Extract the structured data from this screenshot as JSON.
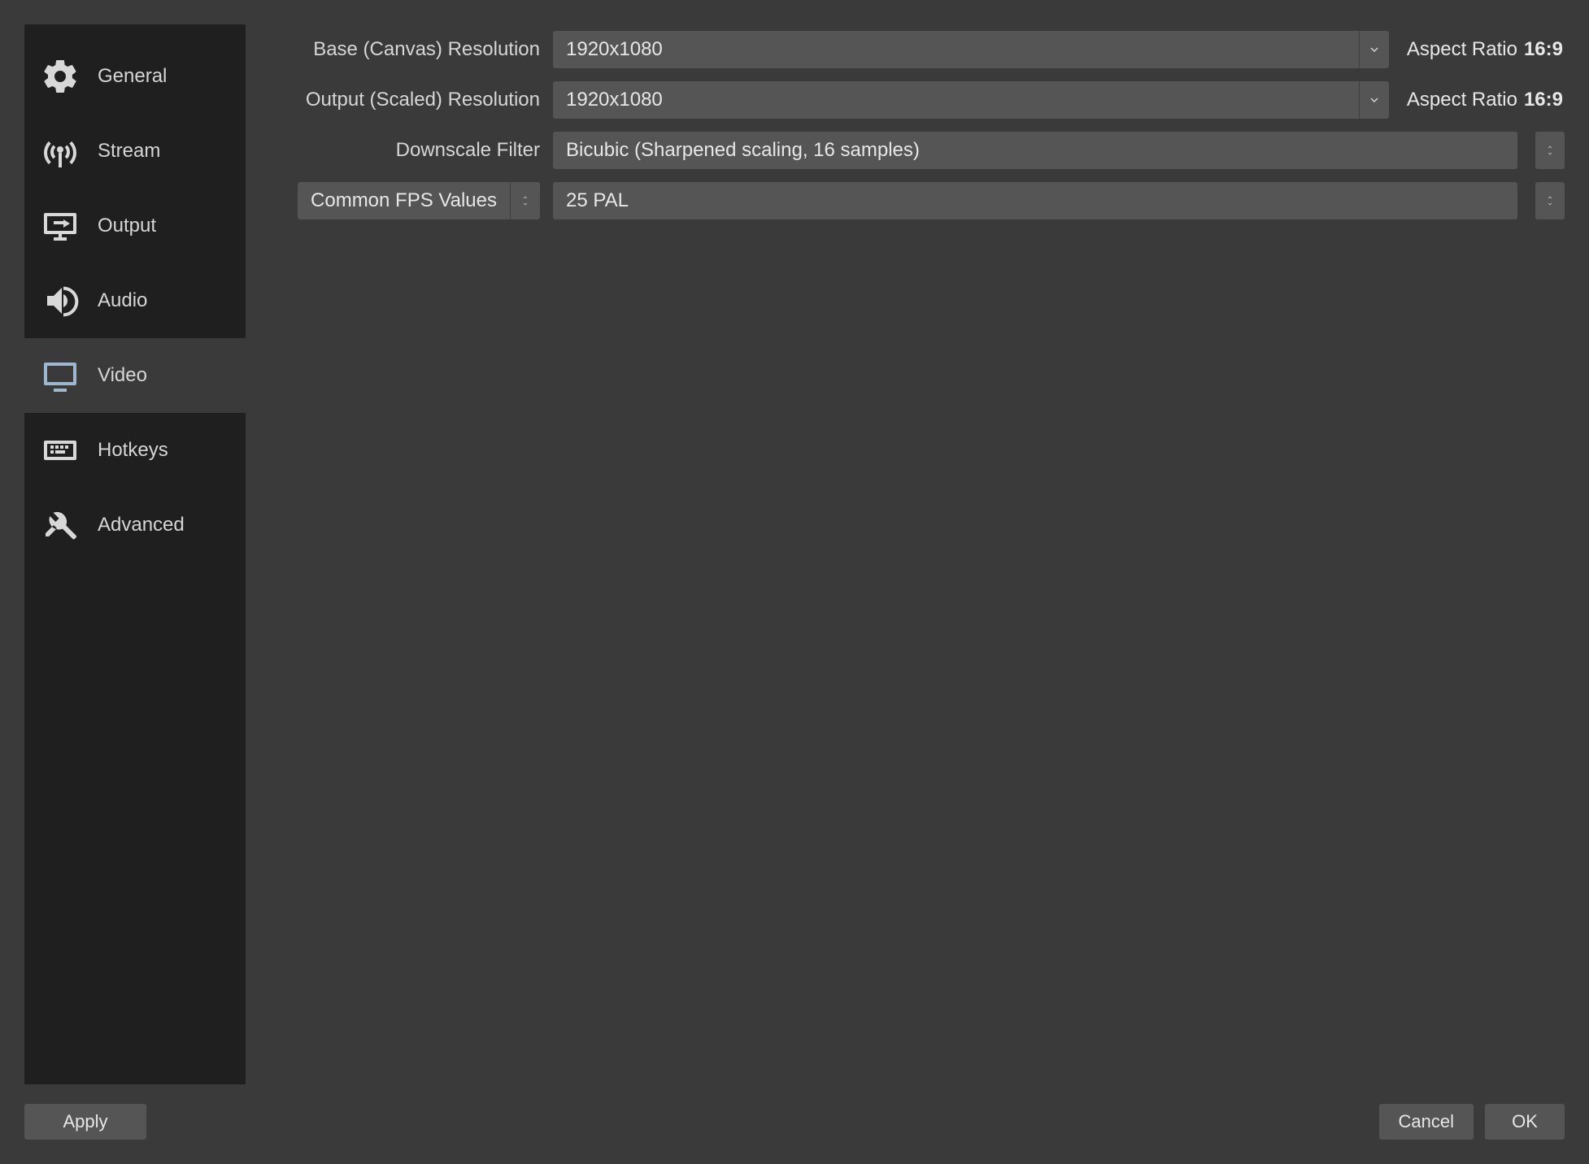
{
  "sidebar": {
    "items": [
      {
        "label": "General"
      },
      {
        "label": "Stream"
      },
      {
        "label": "Output"
      },
      {
        "label": "Audio"
      },
      {
        "label": "Video"
      },
      {
        "label": "Hotkeys"
      },
      {
        "label": "Advanced"
      }
    ],
    "active_index": 4
  },
  "video": {
    "base_label": "Base (Canvas) Resolution",
    "base_value": "1920x1080",
    "base_aspect_label": "Aspect Ratio",
    "base_aspect_value": "16:9",
    "output_label": "Output (Scaled) Resolution",
    "output_value": "1920x1080",
    "output_aspect_label": "Aspect Ratio",
    "output_aspect_value": "16:9",
    "downscale_label": "Downscale Filter",
    "downscale_value": "Bicubic (Sharpened scaling, 16 samples)",
    "fps_type_label": "Common FPS Values",
    "fps_value": "25 PAL"
  },
  "footer": {
    "apply": "Apply",
    "cancel": "Cancel",
    "ok": "OK"
  }
}
